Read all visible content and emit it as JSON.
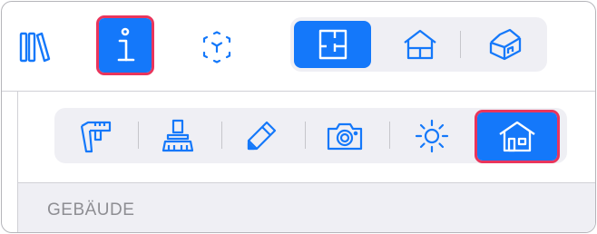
{
  "toolbar": {
    "library_icon": "library-books-icon",
    "info_icon": "info-icon",
    "ar_icon": "augmented-reality-cube-icon",
    "view_modes": [
      {
        "icon": "floor-plan-icon",
        "selected": true
      },
      {
        "icon": "house-section-icon",
        "selected": false
      },
      {
        "icon": "house-3d-icon",
        "selected": false
      }
    ]
  },
  "inspector": {
    "tools": [
      {
        "icon": "measure-caliper-icon",
        "selected": false
      },
      {
        "icon": "stamp-icon",
        "selected": false
      },
      {
        "icon": "pencil-icon",
        "selected": false
      },
      {
        "icon": "camera-icon",
        "selected": false
      },
      {
        "icon": "sun-icon",
        "selected": false
      },
      {
        "icon": "building-icon",
        "selected": true
      }
    ],
    "section_title": "GEBÄUDE"
  },
  "colors": {
    "accent": "#1478fa",
    "highlight": "#e9355c",
    "segment_bg": "#efeff4",
    "section_text": "#8e8e93"
  }
}
